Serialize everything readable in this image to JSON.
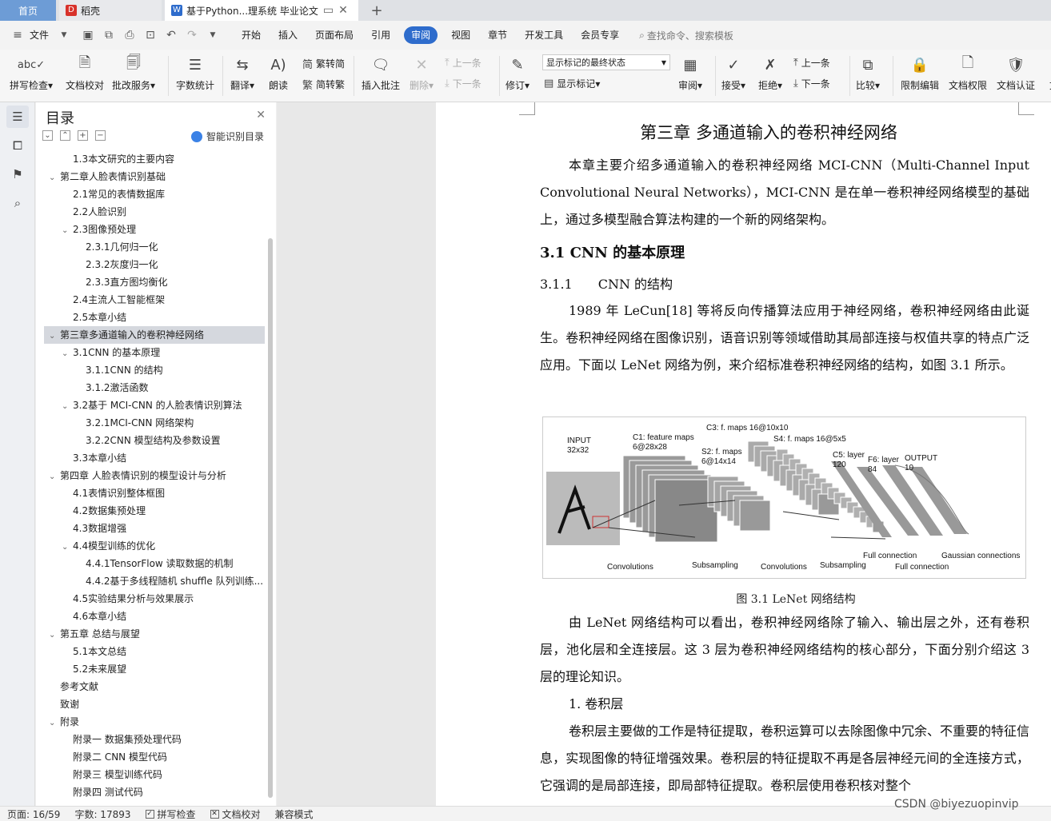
{
  "tabs": {
    "home": "首页",
    "doc1": "稻壳",
    "doc2": "基于Python...理系统 毕业论文"
  },
  "menu": {
    "file": "文件",
    "items": [
      "开始",
      "插入",
      "页面布局",
      "引用",
      "审阅",
      "视图",
      "章节",
      "开发工具",
      "会员专享"
    ],
    "active": "审阅",
    "search": "查找命令、搜索模板"
  },
  "ribbon": {
    "spell": "拼写检查",
    "proof": "文档校对",
    "batch": "批改服务",
    "wordcount": "字数统计",
    "translate": "翻译",
    "read": "朗读",
    "tofan": "繁转简",
    "tojian": "简转繁",
    "insert_comment": "插入批注",
    "delete": "删除",
    "prev1": "上一条",
    "next1": "下一条",
    "revise": "修订",
    "markup_select": "显示标记的最终状态",
    "show_markup": "显示标记",
    "review": "审阅",
    "accept": "接受",
    "reject": "拒绝",
    "prev2": "上一条",
    "next2": "下一条",
    "compare": "比较",
    "restrict": "限制编辑",
    "permission": "文档权限",
    "certify": "文档认证",
    "cut_label": "文"
  },
  "nav": {
    "title": "目录",
    "smart": "智能识别目录",
    "toc": [
      {
        "text": "1.3本文研究的主要内容",
        "level": 2,
        "caret": ""
      },
      {
        "text": "第二章人脸表情识别基础",
        "level": 1,
        "caret": "v"
      },
      {
        "text": "2.1常见的表情数据库",
        "level": 2,
        "caret": ""
      },
      {
        "text": "2.2人脸识别",
        "level": 2,
        "caret": ""
      },
      {
        "text": "2.3图像预处理",
        "level": 2,
        "caret": "v"
      },
      {
        "text": "2.3.1几何归一化",
        "level": 3,
        "caret": ""
      },
      {
        "text": "2.3.2灰度归一化",
        "level": 3,
        "caret": ""
      },
      {
        "text": "2.3.3直方图均衡化",
        "level": 3,
        "caret": ""
      },
      {
        "text": "2.4主流人工智能框架",
        "level": 2,
        "caret": ""
      },
      {
        "text": "2.5本章小结",
        "level": 2,
        "caret": ""
      },
      {
        "text": "第三章多通道输入的卷积神经网络",
        "level": 1,
        "caret": "v",
        "selected": true
      },
      {
        "text": "3.1CNN 的基本原理",
        "level": 2,
        "caret": "v"
      },
      {
        "text": "3.1.1CNN 的结构",
        "level": 3,
        "caret": ""
      },
      {
        "text": "3.1.2激活函数",
        "level": 3,
        "caret": ""
      },
      {
        "text": "3.2基于 MCI-CNN 的人脸表情识别算法",
        "level": 2,
        "caret": "v"
      },
      {
        "text": "3.2.1MCI-CNN 网络架构",
        "level": 3,
        "caret": ""
      },
      {
        "text": "3.2.2CNN 模型结构及参数设置",
        "level": 3,
        "caret": ""
      },
      {
        "text": "3.3本章小结",
        "level": 2,
        "caret": ""
      },
      {
        "text": "第四章 人脸表情识别的模型设计与分析",
        "level": 1,
        "caret": "v"
      },
      {
        "text": "4.1表情识别整体框图",
        "level": 2,
        "caret": ""
      },
      {
        "text": "4.2数据集预处理",
        "level": 2,
        "caret": ""
      },
      {
        "text": "4.3数据增强",
        "level": 2,
        "caret": ""
      },
      {
        "text": "4.4模型训练的优化",
        "level": 2,
        "caret": "v"
      },
      {
        "text": "4.4.1TensorFlow 读取数据的机制",
        "level": 3,
        "caret": ""
      },
      {
        "text": "4.4.2基于多线程随机 shuffle 队列训练...",
        "level": 3,
        "caret": ""
      },
      {
        "text": "4.5实验结果分析与效果展示",
        "level": 2,
        "caret": ""
      },
      {
        "text": "4.6本章小结",
        "level": 2,
        "caret": ""
      },
      {
        "text": "第五章 总结与展望",
        "level": 1,
        "caret": "v"
      },
      {
        "text": "5.1本文总结",
        "level": 2,
        "caret": ""
      },
      {
        "text": "5.2未来展望",
        "level": 2,
        "caret": ""
      },
      {
        "text": "参考文献",
        "level": 1,
        "caret": ""
      },
      {
        "text": "致谢",
        "level": 1,
        "caret": ""
      },
      {
        "text": "附录",
        "level": 1,
        "caret": "v"
      },
      {
        "text": "附录一 数据集预处理代码",
        "level": 2,
        "caret": ""
      },
      {
        "text": "附录二 CNN 模型代码",
        "level": 2,
        "caret": ""
      },
      {
        "text": "附录三 模型训练代码",
        "level": 2,
        "caret": ""
      },
      {
        "text": "附录四 测试代码",
        "level": 2,
        "caret": ""
      }
    ]
  },
  "doc": {
    "chapter_title": "第三章 多通道输入的卷积神经网络",
    "p1": "本章主要介绍多通道输入的卷积神经网络 MCI-CNN（Multi-Channel Input Convolutional Neural Networks），MCI-CNN 是在单一卷积神经网络模型的基础上，通过多模型融合算法构建的一个新的网络架构。",
    "h_31": "3.1 CNN 的基本原理",
    "h_311": "3.1.1　　CNN 的结构",
    "p2": "1989 年 LeCun[18] 等将反向传播算法应用于神经网络，卷积神经网络由此诞生。卷积神经网络在图像识别，语音识别等领域借助其局部连接与权值共享的特点广泛应用。下面以 LeNet 网络为例，来介绍标准卷积神经网络的结构，如图 3.1 所示。",
    "figure": {
      "input": "INPUT",
      "input_size": "32x32",
      "c1": "C1: feature maps",
      "c1_size": "6@28x28",
      "c3": "C3: f. maps 16@10x10",
      "s2": "S2: f. maps",
      "s2_size": "6@14x14",
      "s4": "S4: f. maps 16@5x5",
      "c5": "C5: layer",
      "c5_size": "120",
      "f6": "F6: layer",
      "f6_size": "84",
      "output": "OUTPUT",
      "output_size": "10",
      "conv1": "Convolutions",
      "sub1": "Subsampling",
      "conv2": "Convolutions",
      "sub2": "Subsampling",
      "fc1": "Full connection",
      "fc2": "Full connection",
      "gauss": "Gaussian connections"
    },
    "caption": "图 3.1  LeNet 网络结构",
    "p3": "由 LeNet 网络结构可以看出，卷积神经网络除了输入、输出层之外，还有卷积层，池化层和全连接层。这 3 层为卷积神经网络结构的核心部分，下面分别介绍这 3 层的理论知识。",
    "item1": "1.  卷积层",
    "p4": "卷积层主要做的工作是特征提取，卷积运算可以去除图像中冗余、不重要的特征信息，实现图像的特征增强效果。卷积层的特征提取不再是各层神经元间的全连接方式，它强调的是局部连接，即局部特征提取。卷积层使用卷积核对整个"
  },
  "status": {
    "page": "页面: 16/59",
    "words": "字数: 17893",
    "spell": "拼写检查",
    "proof": "文档校对",
    "compat": "兼容模式"
  },
  "watermark": "CSDN @biyezuopinvip"
}
